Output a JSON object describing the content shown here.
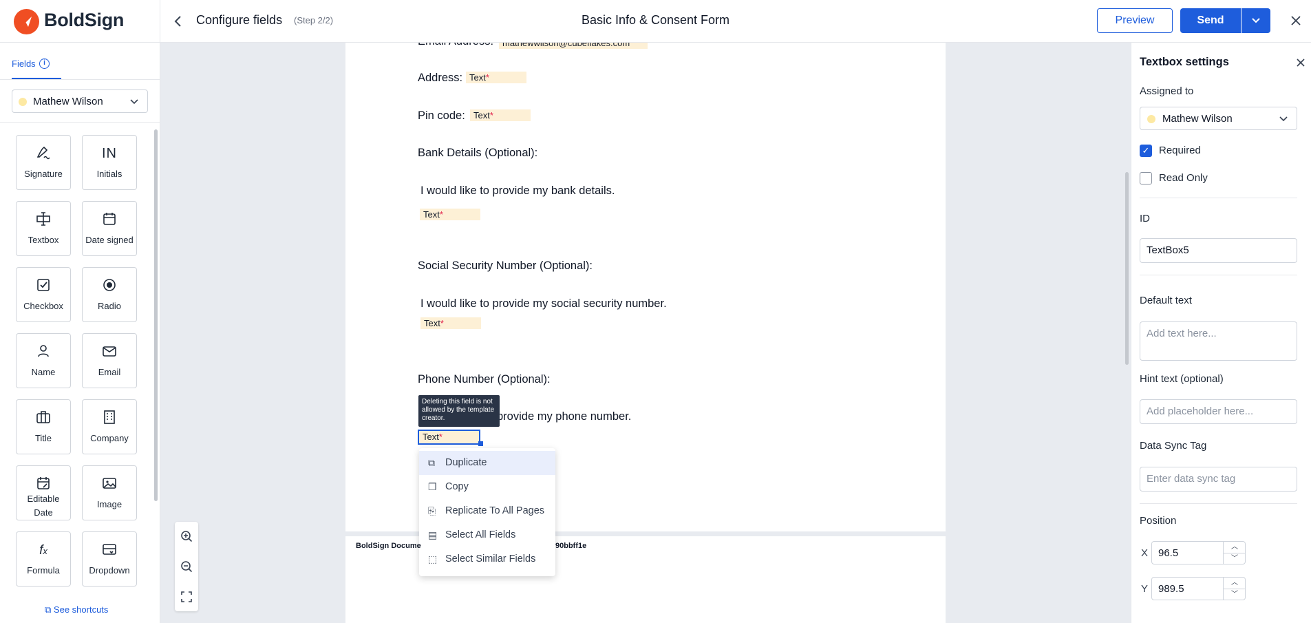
{
  "header": {
    "brand": "BoldSign",
    "page_title": "Configure fields",
    "step": "(Step 2/2)",
    "document_title": "Basic Info & Consent Form",
    "preview_label": "Preview",
    "send_label": "Send",
    "brand_color": "#f04e23",
    "accent_color": "#1e5ddc"
  },
  "left_panel": {
    "tab_label": "Fields",
    "signer": "Mathew Wilson",
    "signer_color": "#fde9a3",
    "tiles": [
      {
        "label": "Signature",
        "icon": "signature-icon"
      },
      {
        "label": "Initials",
        "icon": "initials-icon"
      },
      {
        "label": "Textbox",
        "icon": "textbox-icon"
      },
      {
        "label": "Date signed",
        "icon": "calendar-icon"
      },
      {
        "label": "Checkbox",
        "icon": "checkbox-icon"
      },
      {
        "label": "Radio",
        "icon": "radio-icon"
      },
      {
        "label": "Name",
        "icon": "person-icon"
      },
      {
        "label": "Email",
        "icon": "mail-icon"
      },
      {
        "label": "Title",
        "icon": "briefcase-icon"
      },
      {
        "label": "Company",
        "icon": "building-icon"
      },
      {
        "label": "Editable\nDate",
        "icon": "editable-date-icon"
      },
      {
        "label": "Image",
        "icon": "image-icon"
      },
      {
        "label": "Formula",
        "icon": "formula-icon"
      },
      {
        "label": "Dropdown",
        "icon": "dropdown-icon"
      }
    ],
    "shortcuts_label": "See shortcuts"
  },
  "document": {
    "email_line": "Email Address:",
    "email_value": "mathewwilson@cubeflakes.com",
    "address_label": "Address:",
    "pin_label": "Pin code:",
    "bank_heading": "Bank Details (Optional):",
    "bank_text": "I would like to provide my bank details.",
    "ssn_heading": "Social Security Number (Optional):",
    "ssn_text": "I would like to provide my social security number.",
    "phone_heading": "Phone Number (Optional):",
    "phone_text": "I would like to provide my phone number.",
    "phone_text_visible": "provide my phone number.",
    "field_text": "Text",
    "required_mark": "*",
    "footer_left": "BoldSign Docume",
    "footer_right": "90bbff1e"
  },
  "tooltip": "Deleting this field is not allowed by the template creator.",
  "context_menu": {
    "items": [
      {
        "label": "Duplicate",
        "icon": "duplicate-icon"
      },
      {
        "label": "Copy",
        "icon": "copy-icon"
      },
      {
        "label": "Replicate To All Pages",
        "icon": "replicate-icon"
      },
      {
        "label": "Select All Fields",
        "icon": "select-all-icon"
      },
      {
        "label": "Select Similar Fields",
        "icon": "select-similar-icon"
      }
    ]
  },
  "right_panel": {
    "title": "Textbox settings",
    "assigned_label": "Assigned to",
    "assigned_value": "Mathew Wilson",
    "required_label": "Required",
    "required_checked": true,
    "readonly_label": "Read Only",
    "readonly_checked": false,
    "id_label": "ID",
    "id_value": "TextBox5",
    "default_label": "Default text",
    "default_placeholder": "Add text here...",
    "hint_label": "Hint text (optional)",
    "hint_placeholder": "Add placeholder here...",
    "sync_label": "Data Sync Tag",
    "sync_placeholder": "Enter data sync tag",
    "position_label": "Position",
    "x_label": "X",
    "x_value": "96.5",
    "y_label": "Y",
    "y_value": "989.5"
  }
}
